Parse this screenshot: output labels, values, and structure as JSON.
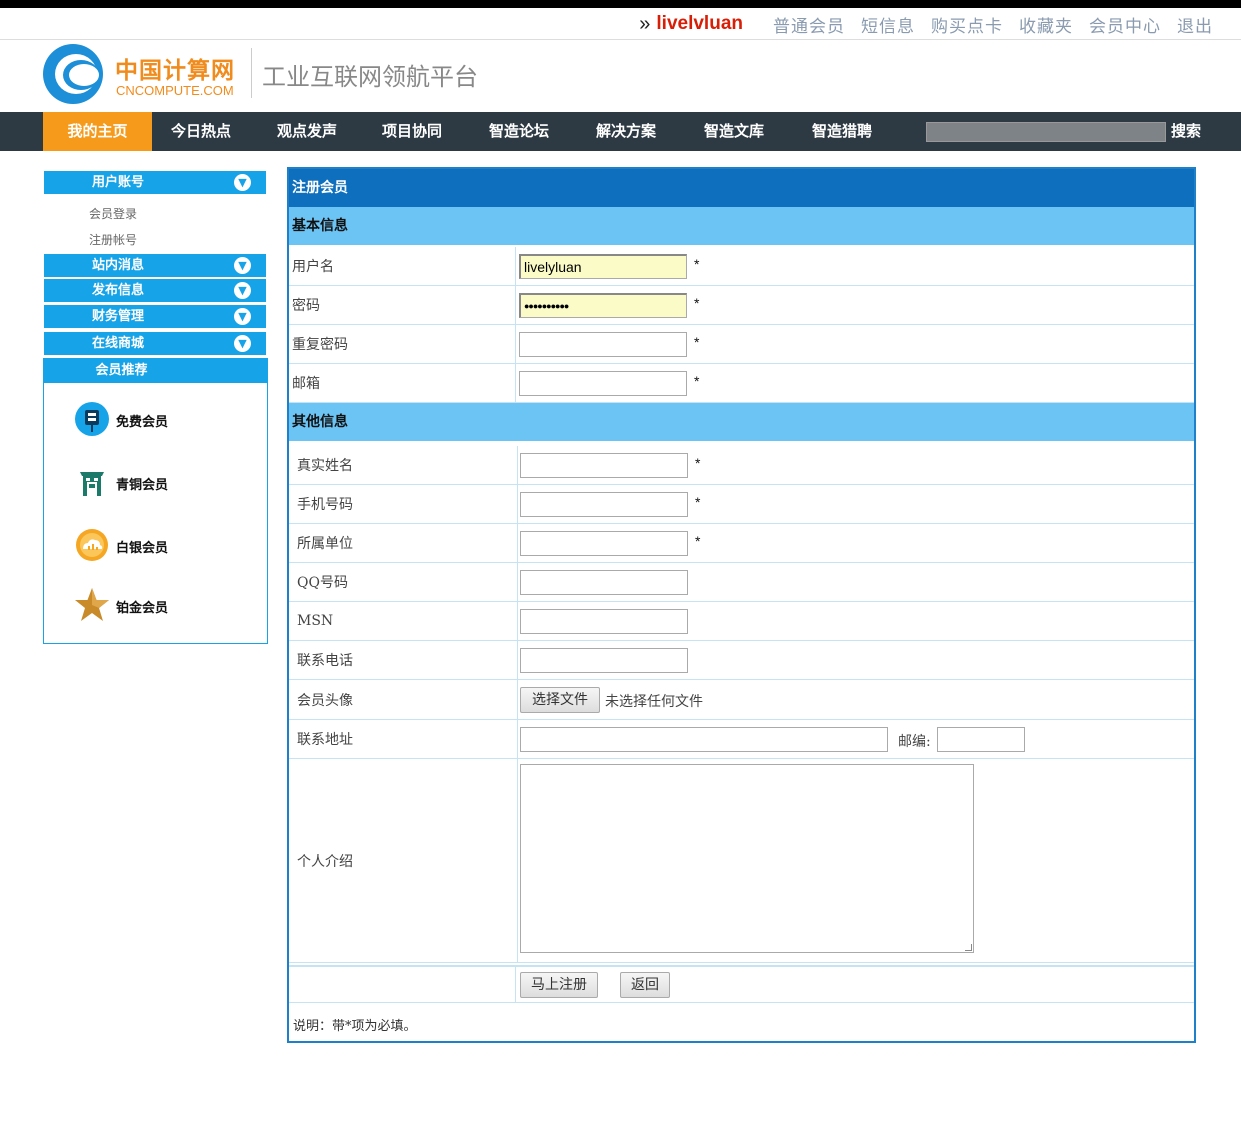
{
  "userbar": {
    "prefix": "»",
    "username": "livelvluan",
    "links": [
      "普通会员",
      "短信息",
      "购买点卡",
      "收藏夹",
      "会员中心",
      "退出"
    ]
  },
  "logo": {
    "cn": "中国计算网",
    "en": "CNCOMPUTE.COM"
  },
  "slogan": "工业互联网领航平台",
  "nav": {
    "items": [
      "我的主页",
      "今日热点",
      "观点发声",
      "项目协同",
      "智造论坛",
      "解决方案",
      "智造文库",
      "智造猎聘"
    ],
    "active_index": 0,
    "search_label": "搜索"
  },
  "sidebar": {
    "account_head": "用户账号",
    "account_items": [
      "会员登录",
      "注册帐号"
    ],
    "sections": [
      "站内消息",
      "发布信息",
      "财务管理",
      "在线商城"
    ],
    "recommend_head": "会员推荐",
    "members": [
      "免费会员",
      "青铜会员",
      "白银会员",
      "铂金会员"
    ]
  },
  "form": {
    "title": "注册会员",
    "basic_title": "基本信息",
    "basic": [
      {
        "label": "用户名",
        "value": "livelyluan",
        "required": true
      },
      {
        "label": "密码",
        "value": "●●●●●●●●●●",
        "required": true
      },
      {
        "label": "重复密码",
        "value": "",
        "required": true
      },
      {
        "label": "邮箱",
        "value": "",
        "required": true
      }
    ],
    "other_title": "其他信息",
    "other": [
      {
        "label": "真实姓名",
        "required": true
      },
      {
        "label": "手机号码",
        "required": true
      },
      {
        "label": "所属单位",
        "required": true
      },
      {
        "label": "QQ号码",
        "required": false
      },
      {
        "label": "MSN",
        "required": false
      },
      {
        "label": "联系电话",
        "required": false
      }
    ],
    "avatar_label": "会员头像",
    "file_button": "选择文件",
    "file_status": "未选择任何文件",
    "address_label": "联系地址",
    "zip_label": "邮编:",
    "intro_label": "个人介绍",
    "submit": "马上注册",
    "back": "返回",
    "note": "说明：带*项为必填。",
    "required_mark": "*"
  },
  "colors": {
    "nav_bg": "#2d3a44",
    "nav_active": "#f59a1b",
    "sidebar_blue": "#16a3e8",
    "title_blue": "#0d6fbd",
    "section_blue": "#6cc4f5",
    "username_red": "#d81e06"
  }
}
